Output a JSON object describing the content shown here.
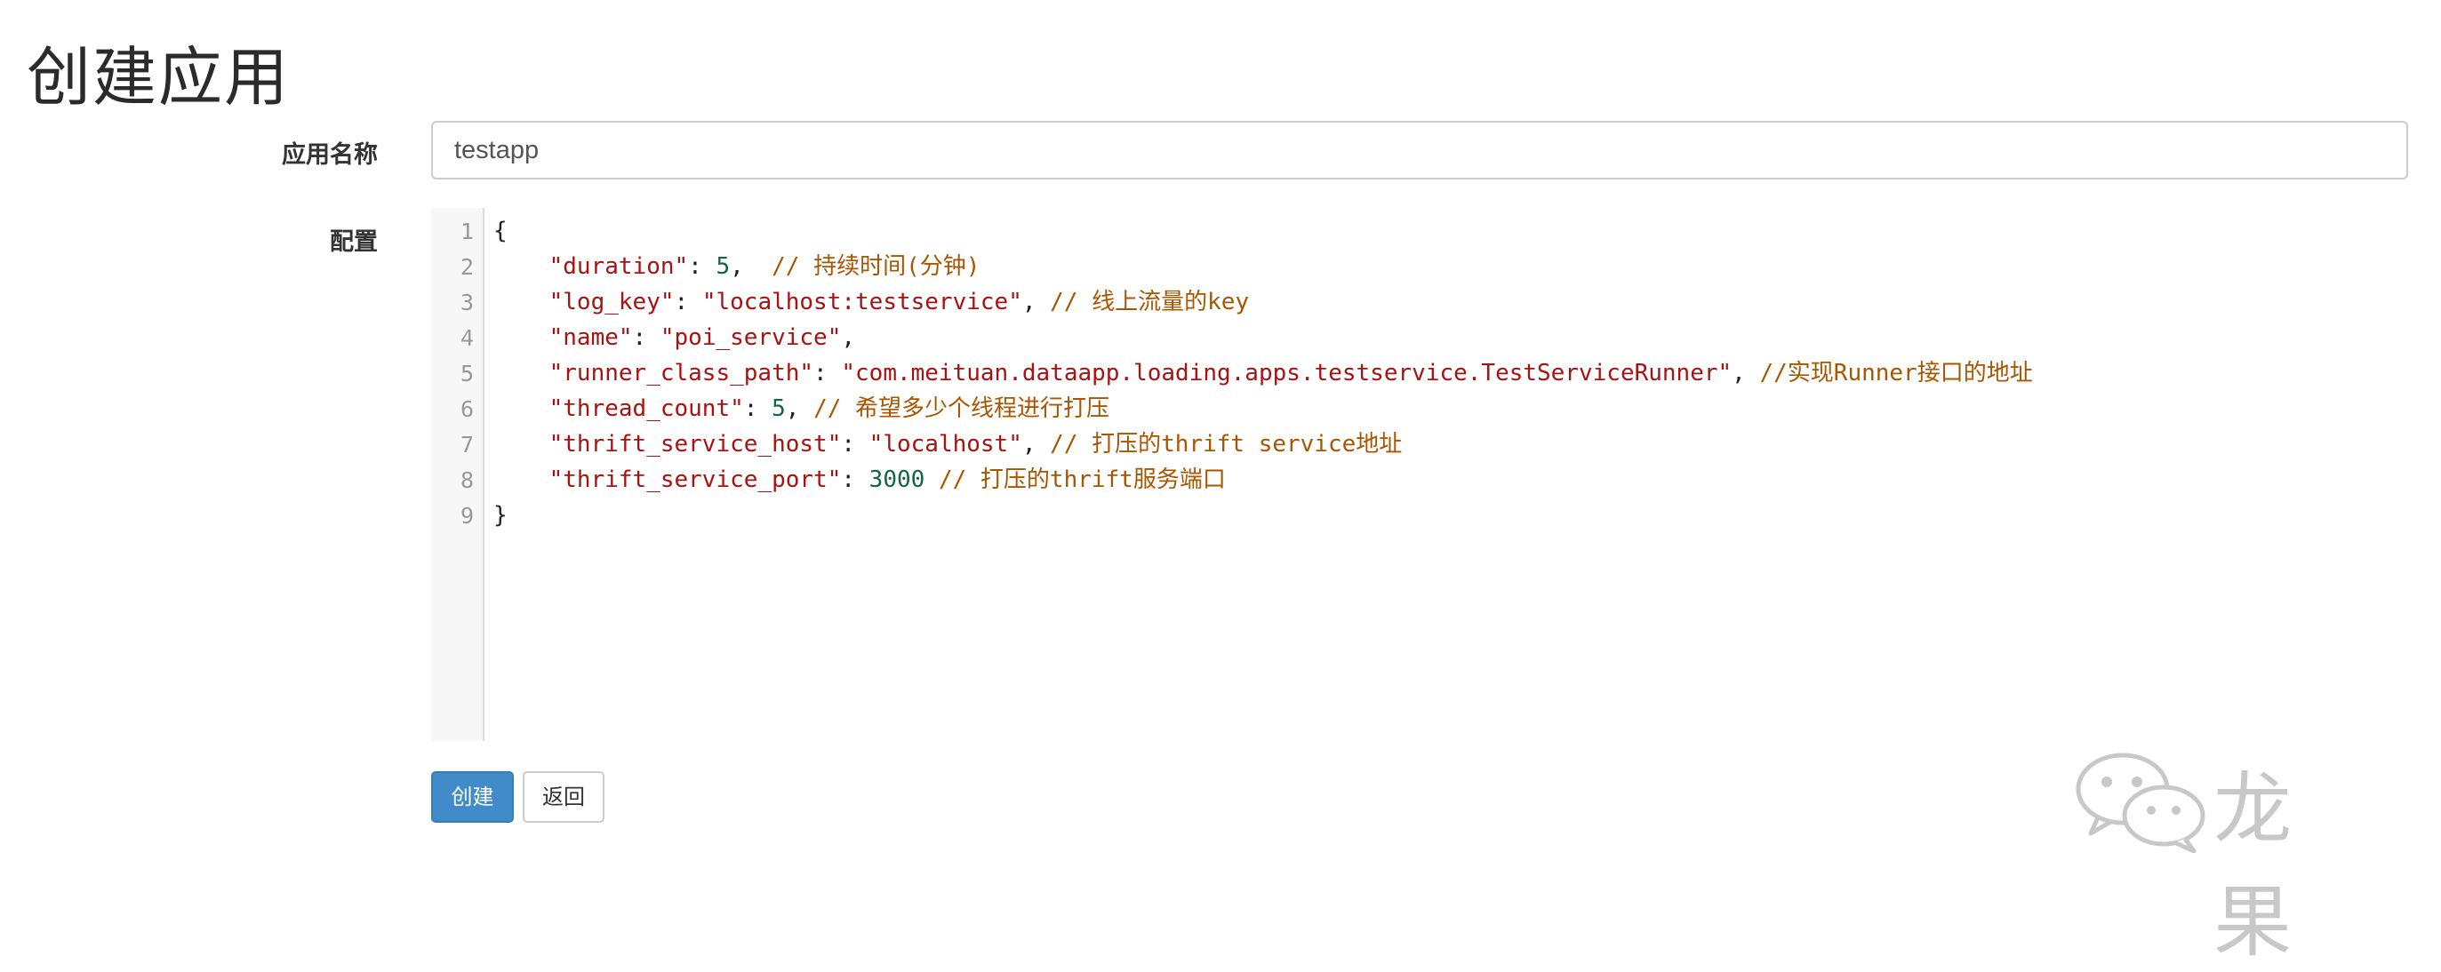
{
  "page": {
    "title": "创建应用"
  },
  "form": {
    "name_label": "应用名称",
    "name_value": "testapp",
    "config_label": "配置"
  },
  "editor": {
    "line_numbers": [
      "1",
      "2",
      "3",
      "4",
      "5",
      "6",
      "7",
      "8",
      "9"
    ],
    "lines": [
      [
        {
          "t": "p",
          "v": "{"
        }
      ],
      [
        {
          "t": "p",
          "v": "    "
        },
        {
          "t": "k",
          "v": "\"duration\""
        },
        {
          "t": "p",
          "v": ": "
        },
        {
          "t": "n",
          "v": "5"
        },
        {
          "t": "p",
          "v": ",  "
        },
        {
          "t": "c",
          "v": "// 持续时间(分钟)"
        }
      ],
      [
        {
          "t": "p",
          "v": "    "
        },
        {
          "t": "k",
          "v": "\"log_key\""
        },
        {
          "t": "p",
          "v": ": "
        },
        {
          "t": "s",
          "v": "\"localhost:testservice\""
        },
        {
          "t": "p",
          "v": ", "
        },
        {
          "t": "c",
          "v": "// 线上流量的key"
        }
      ],
      [
        {
          "t": "p",
          "v": "    "
        },
        {
          "t": "k",
          "v": "\"name\""
        },
        {
          "t": "p",
          "v": ": "
        },
        {
          "t": "s",
          "v": "\"poi_service\""
        },
        {
          "t": "p",
          "v": ","
        }
      ],
      [
        {
          "t": "p",
          "v": "    "
        },
        {
          "t": "k",
          "v": "\"runner_class_path\""
        },
        {
          "t": "p",
          "v": ": "
        },
        {
          "t": "s",
          "v": "\"com.meituan.dataapp.loading.apps.testservice.TestServiceRunner\""
        },
        {
          "t": "p",
          "v": ", "
        },
        {
          "t": "c",
          "v": "//实现Runner接口的地址"
        }
      ],
      [
        {
          "t": "p",
          "v": "    "
        },
        {
          "t": "k",
          "v": "\"thread_count\""
        },
        {
          "t": "p",
          "v": ": "
        },
        {
          "t": "n",
          "v": "5"
        },
        {
          "t": "p",
          "v": ", "
        },
        {
          "t": "c",
          "v": "// 希望多少个线程进行打压"
        }
      ],
      [
        {
          "t": "p",
          "v": "    "
        },
        {
          "t": "k",
          "v": "\"thrift_service_host\""
        },
        {
          "t": "p",
          "v": ": "
        },
        {
          "t": "s",
          "v": "\"localhost\""
        },
        {
          "t": "p",
          "v": ", "
        },
        {
          "t": "c",
          "v": "// 打压的thrift service地址"
        }
      ],
      [
        {
          "t": "p",
          "v": "    "
        },
        {
          "t": "k",
          "v": "\"thrift_service_port\""
        },
        {
          "t": "p",
          "v": ": "
        },
        {
          "t": "n",
          "v": "3000"
        },
        {
          "t": "p",
          "v": " "
        },
        {
          "t": "c",
          "v": "// 打压的thrift服务端口"
        }
      ],
      [
        {
          "t": "p",
          "v": "}"
        }
      ]
    ]
  },
  "buttons": {
    "create_label": "创建",
    "back_label": "返回"
  },
  "watermark": {
    "icon": "wechat-icon",
    "text": "龙果"
  },
  "colors": {
    "primary": "#428bca",
    "key": "#aa1111",
    "number": "#116644",
    "comment": "#aa5500"
  }
}
